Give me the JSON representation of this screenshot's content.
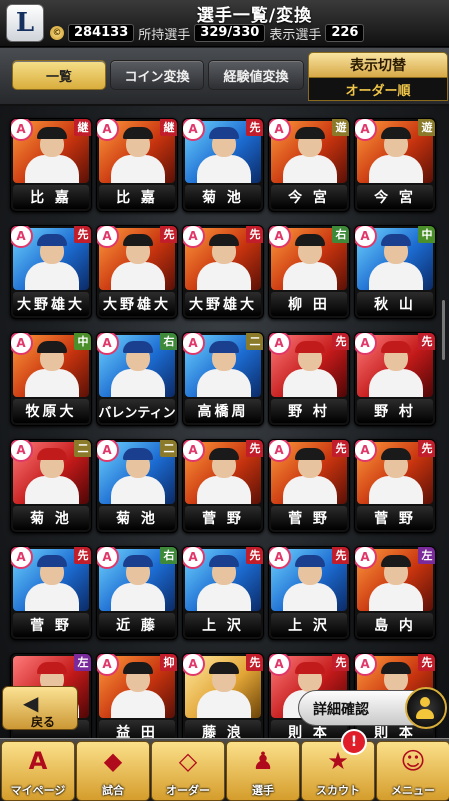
{
  "header": {
    "logo_letter": "L",
    "title": "選手一覧/変換",
    "coin_symbol": "©",
    "coins": "284133",
    "owned_label": "所持選手",
    "owned_value": "329/330",
    "shown_label": "表示選手",
    "shown_value": "226"
  },
  "tabs": [
    {
      "label": "一覧",
      "active": true
    },
    {
      "label": "コイン変換",
      "active": false
    },
    {
      "label": "経験値変換",
      "active": false
    }
  ],
  "display_toggle": {
    "label": "表示切替",
    "value": "オーダー順"
  },
  "players": [
    {
      "name": "比 嘉",
      "rank": "A",
      "pos": "継",
      "style": "orange"
    },
    {
      "name": "比 嘉",
      "rank": "A",
      "pos": "継",
      "style": "orange"
    },
    {
      "name": "菊 池",
      "rank": "A",
      "pos": "先",
      "style": "blue"
    },
    {
      "name": "今 宮",
      "rank": "A",
      "pos": "遊",
      "style": "orange"
    },
    {
      "name": "今 宮",
      "rank": "A",
      "pos": "遊",
      "style": "orange"
    },
    {
      "name": "大野雄大",
      "rank": "A",
      "pos": "先",
      "style": "blue"
    },
    {
      "name": "大野雄大",
      "rank": "A",
      "pos": "先",
      "style": "orange"
    },
    {
      "name": "大野雄大",
      "rank": "A",
      "pos": "先",
      "style": "orange"
    },
    {
      "name": "柳 田",
      "rank": "A",
      "pos": "右",
      "style": "orange"
    },
    {
      "name": "秋 山",
      "rank": "A",
      "pos": "中",
      "style": "blue"
    },
    {
      "name": "牧原大",
      "rank": "A",
      "pos": "中",
      "style": "orange"
    },
    {
      "name": "バレンティン",
      "rank": "A",
      "pos": "右",
      "style": "blue"
    },
    {
      "name": "高橋周",
      "rank": "A",
      "pos": "二",
      "style": "blue"
    },
    {
      "name": "野 村",
      "rank": "A",
      "pos": "先",
      "style": "red"
    },
    {
      "name": "野 村",
      "rank": "A",
      "pos": "先",
      "style": "red"
    },
    {
      "name": "菊 池",
      "rank": "A",
      "pos": "二",
      "style": "red"
    },
    {
      "name": "菊 池",
      "rank": "A",
      "pos": "二",
      "style": "blue"
    },
    {
      "name": "菅 野",
      "rank": "A",
      "pos": "先",
      "style": "orange"
    },
    {
      "name": "菅 野",
      "rank": "A",
      "pos": "先",
      "style": "orange"
    },
    {
      "name": "菅 野",
      "rank": "A",
      "pos": "先",
      "style": "orange"
    },
    {
      "name": "菅 野",
      "rank": "A",
      "pos": "先",
      "style": "blue"
    },
    {
      "name": "近 藤",
      "rank": "A",
      "pos": "右",
      "style": "blue"
    },
    {
      "name": "上 沢",
      "rank": "A",
      "pos": "先",
      "style": "blue"
    },
    {
      "name": "上 沢",
      "rank": "A",
      "pos": "先",
      "style": "blue"
    },
    {
      "name": "島 内",
      "rank": "A",
      "pos": "左",
      "style": "orange"
    },
    {
      "name": "",
      "rank": "",
      "pos": "左",
      "style": "red"
    },
    {
      "name": "益 田",
      "rank": "A",
      "pos": "抑",
      "style": "orange"
    },
    {
      "name": "藤 浪",
      "rank": "A",
      "pos": "先",
      "style": "gold"
    },
    {
      "name": "則 本",
      "rank": "A",
      "pos": "先",
      "style": "red"
    },
    {
      "name": "則 本",
      "rank": "A",
      "pos": "先",
      "style": "orange"
    }
  ],
  "back_button": {
    "label": "戻る"
  },
  "detail_button": {
    "label": "詳細確認"
  },
  "nav": [
    {
      "label": "マイページ",
      "icon": "A"
    },
    {
      "label": "試合",
      "icon": "◆"
    },
    {
      "label": "オーダー",
      "icon": "◇"
    },
    {
      "label": "選手",
      "icon": "♟"
    },
    {
      "label": "スカウト",
      "icon": "★"
    },
    {
      "label": "メニュー",
      "icon": "☺"
    }
  ],
  "nav_badge": "!"
}
